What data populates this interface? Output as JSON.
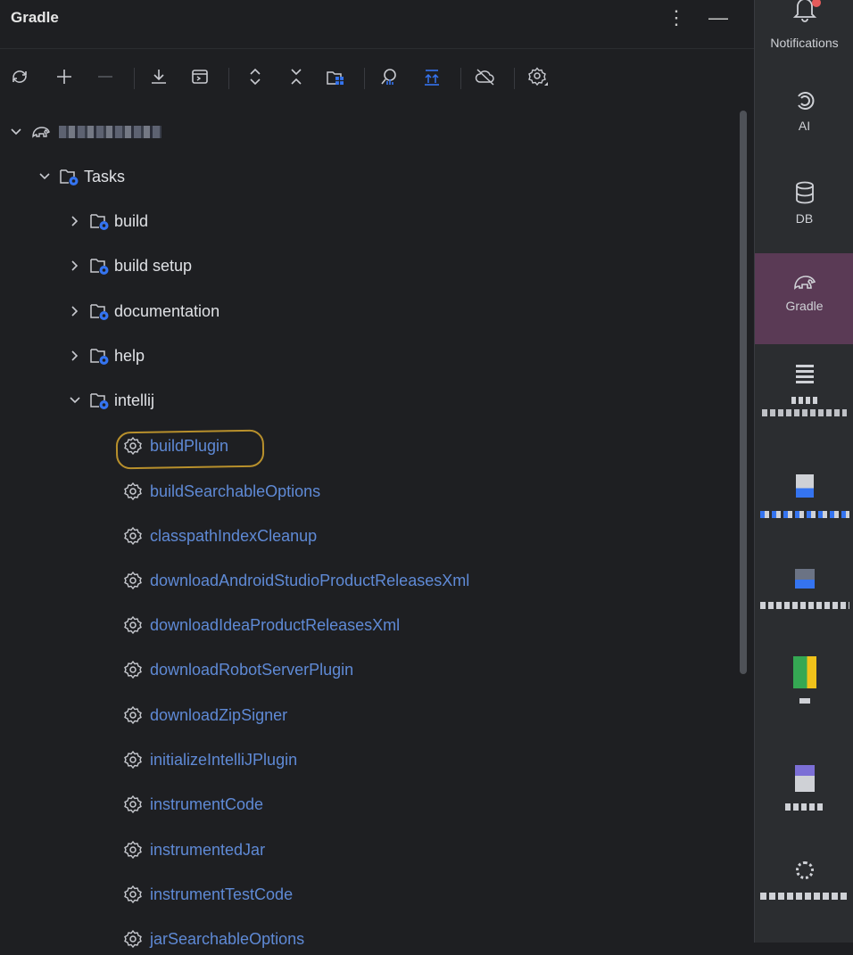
{
  "panel": {
    "title": "Gradle"
  },
  "tree": {
    "root_label": "",
    "tasks_label": "Tasks",
    "groups": [
      "build",
      "build setup",
      "documentation",
      "help"
    ],
    "expanded_group": "intellij",
    "tasks": [
      "buildPlugin",
      "buildSearchableOptions",
      "classpathIndexCleanup",
      "downloadAndroidStudioProductReleasesXml",
      "downloadIdeaProductReleasesXml",
      "downloadRobotServerPlugin",
      "downloadZipSigner",
      "initializeIntelliJPlugin",
      "instrumentCode",
      "instrumentedJar",
      "instrumentTestCode",
      "jarSearchableOptions"
    ]
  },
  "rail": {
    "notifications": "Notifications",
    "ai": "AI",
    "db": "DB",
    "gradle": "Gradle"
  },
  "colors": {
    "task_text": "#5f8ad6",
    "highlight": "#b8902c",
    "active_rail": "#5a3a55"
  }
}
